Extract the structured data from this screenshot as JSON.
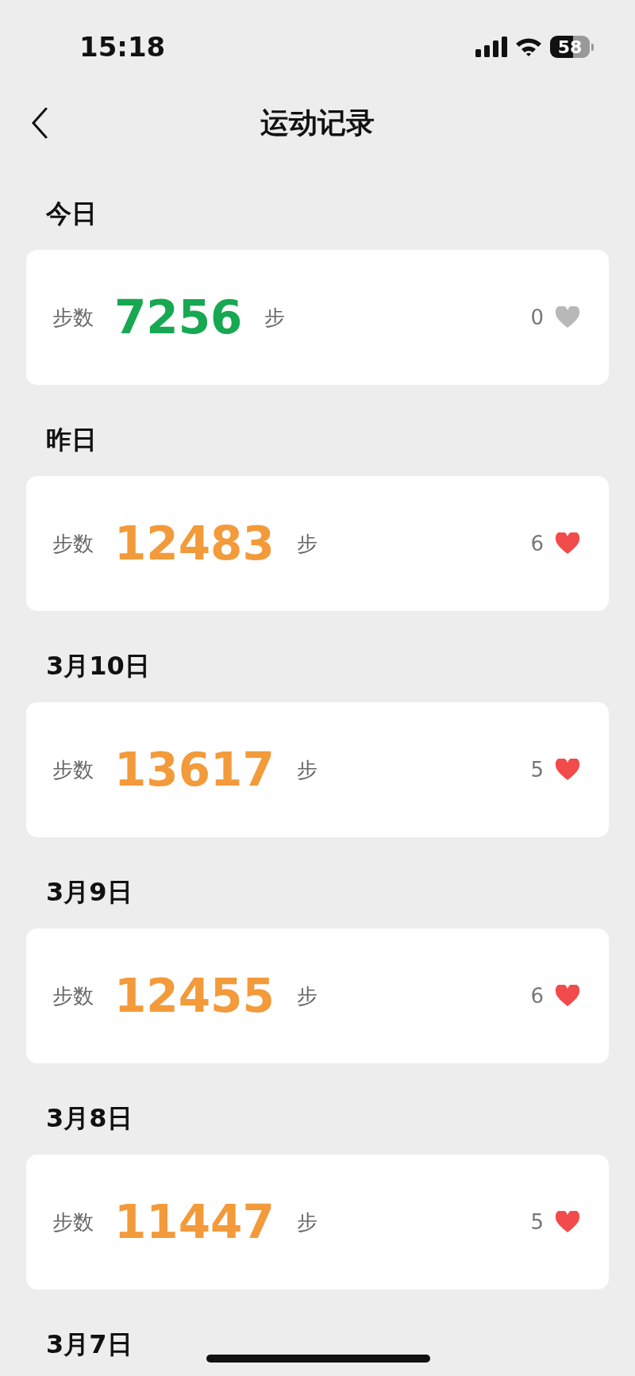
{
  "status_bar": {
    "time": "15:18",
    "battery": "58"
  },
  "nav": {
    "title": "运动记录"
  },
  "days": [
    {
      "label": "今日",
      "steps_label": "步数",
      "steps": "7256",
      "unit": "步",
      "color": "#17a852",
      "likes": "0",
      "liked": false
    },
    {
      "label": "昨日",
      "steps_label": "步数",
      "steps": "12483",
      "unit": "步",
      "color": "#f39a3a",
      "likes": "6",
      "liked": true
    },
    {
      "label": "3月10日",
      "steps_label": "步数",
      "steps": "13617",
      "unit": "步",
      "color": "#f39a3a",
      "likes": "5",
      "liked": true
    },
    {
      "label": "3月9日",
      "steps_label": "步数",
      "steps": "12455",
      "unit": "步",
      "color": "#f39a3a",
      "likes": "6",
      "liked": true
    },
    {
      "label": "3月8日",
      "steps_label": "步数",
      "steps": "11447",
      "unit": "步",
      "color": "#f39a3a",
      "likes": "5",
      "liked": true
    },
    {
      "label": "3月7日"
    }
  ]
}
